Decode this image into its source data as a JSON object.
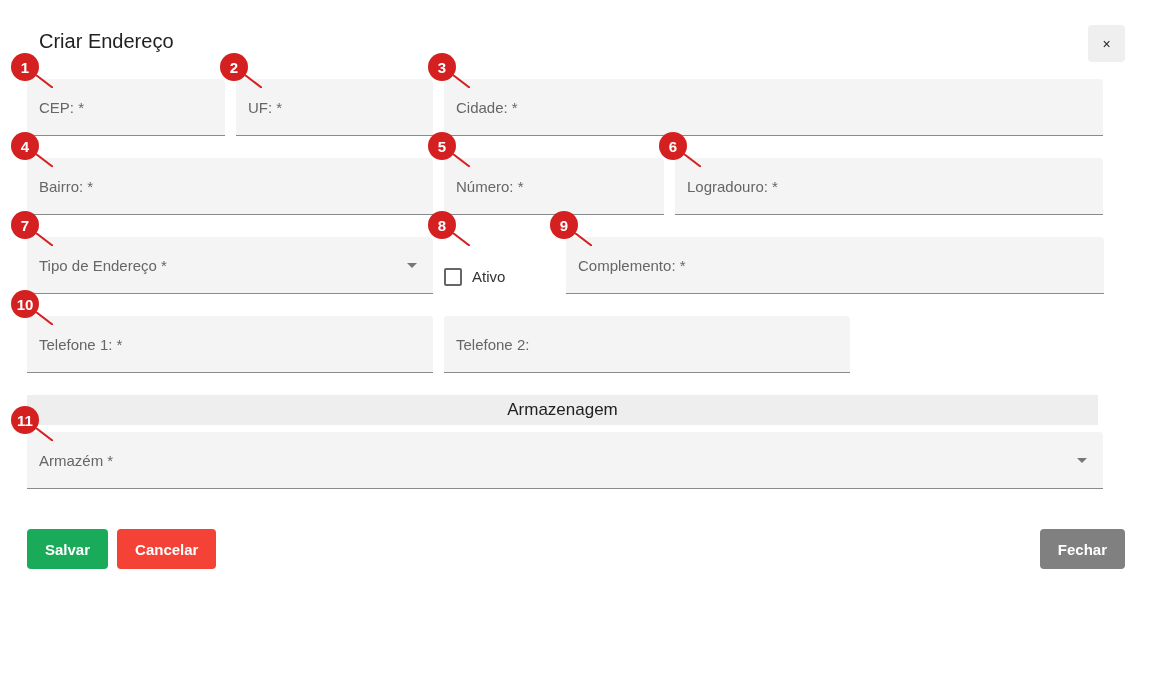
{
  "dialog": {
    "title": "Criar Endereço",
    "close_label": "×"
  },
  "rows": [
    {
      "fields": [
        {
          "kind": "text",
          "label": "CEP: *",
          "marker": "1"
        },
        {
          "kind": "text",
          "label": "UF: *",
          "marker": "2"
        },
        {
          "kind": "text",
          "label": "Cidade: *",
          "marker": "3"
        }
      ]
    },
    {
      "fields": [
        {
          "kind": "text",
          "label": "Bairro: *",
          "marker": "4"
        },
        {
          "kind": "text",
          "label": "Número: *",
          "marker": "5"
        },
        {
          "kind": "text",
          "label": "Logradouro: *",
          "marker": "6"
        }
      ]
    },
    {
      "fields": [
        {
          "kind": "select",
          "label": "Tipo de Endereço *",
          "marker": "7"
        },
        {
          "kind": "checkbox",
          "label": "Ativo",
          "checked": false,
          "marker": "8"
        },
        {
          "kind": "text",
          "label": "Complemento: *",
          "marker": "9"
        }
      ]
    },
    {
      "fields": [
        {
          "kind": "text",
          "label": "Telefone 1: *",
          "marker": "10"
        },
        {
          "kind": "text",
          "label": "Telefone 2:"
        }
      ]
    }
  ],
  "section": {
    "title": "Armazenagem",
    "fields": [
      {
        "kind": "select",
        "label": "Armazém *",
        "marker": "11"
      }
    ]
  },
  "buttons": [
    {
      "kind": "save",
      "label": "Salvar"
    },
    {
      "kind": "cancel",
      "label": "Cancelar"
    },
    {
      "kind": "close",
      "label": "Fechar"
    }
  ]
}
